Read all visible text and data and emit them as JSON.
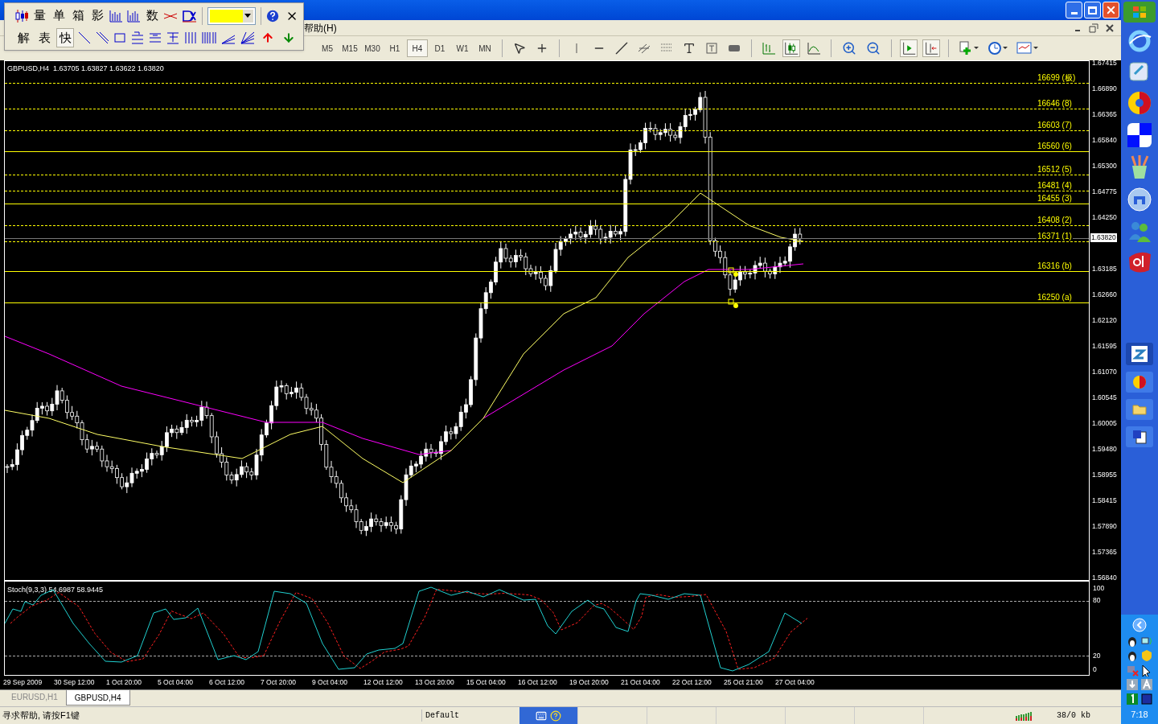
{
  "menu_bar": {
    "items": [
      "帮助(H)"
    ]
  },
  "floating_toolbar": {
    "row1": [
      {
        "kind": "icon"
      },
      {
        "kind": "text",
        "label": "量"
      },
      {
        "kind": "text",
        "label": "单"
      },
      {
        "kind": "text",
        "label": "箱"
      },
      {
        "kind": "text",
        "label": "影"
      },
      {
        "kind": "icon"
      },
      {
        "kind": "icon"
      },
      {
        "kind": "text",
        "label": "数"
      },
      {
        "kind": "icon"
      },
      {
        "kind": "icon"
      }
    ],
    "color_picker": {
      "color": "#ffff00"
    },
    "row2": [
      {
        "kind": "text",
        "label": "解",
        "selected": false
      },
      {
        "kind": "text",
        "label": "表",
        "selected": false
      },
      {
        "kind": "text",
        "label": "快",
        "selected": true
      },
      {
        "kind": "icon"
      },
      {
        "kind": "icon"
      },
      {
        "kind": "icon"
      },
      {
        "kind": "icon"
      },
      {
        "kind": "icon"
      },
      {
        "kind": "icon"
      },
      {
        "kind": "icon"
      },
      {
        "kind": "icon"
      },
      {
        "kind": "icon"
      },
      {
        "kind": "icon"
      },
      {
        "kind": "icon"
      },
      {
        "kind": "icon"
      }
    ]
  },
  "timeframes": [
    {
      "label": "M5",
      "selected": false
    },
    {
      "label": "M15",
      "selected": false
    },
    {
      "label": "M30",
      "selected": false
    },
    {
      "label": "H1",
      "selected": false
    },
    {
      "label": "H4",
      "selected": true
    },
    {
      "label": "D1",
      "selected": false
    },
    {
      "label": "W1",
      "selected": false
    },
    {
      "label": "MN",
      "selected": false
    }
  ],
  "chart": {
    "header": "GBPUSD,H4  1.63705 1.63827 1.63622 1.63820",
    "price_ticks": [
      "1.67415",
      "1.66890",
      "1.66365",
      "1.65840",
      "1.65300",
      "1.64775",
      "1.64250",
      "1.63185",
      "1.62660",
      "1.62120",
      "1.61595",
      "1.61070",
      "1.60545",
      "1.60005",
      "1.59480",
      "1.58955",
      "1.58415",
      "1.57890",
      "1.57365",
      "1.56840"
    ],
    "current_price": "1.63820",
    "fib_levels": [
      {
        "label": "16699 (极)",
        "dashed": true
      },
      {
        "label": "16646 (8)",
        "dashed": true
      },
      {
        "label": "16603 (7)",
        "dashed": true
      },
      {
        "label": "16560 (6)",
        "dashed": false
      },
      {
        "label": "16512 (5)",
        "dashed": true
      },
      {
        "label": "16481 (4)",
        "dashed": true
      },
      {
        "label": "16455 (3)",
        "dashed": false
      },
      {
        "label": "16408 (2)",
        "dashed": true
      },
      {
        "label": "16371 (1)",
        "dashed": true
      },
      {
        "label": "16316 (b)",
        "dashed": false
      },
      {
        "label": "16250 (a)",
        "dashed": false
      }
    ]
  },
  "stochastic": {
    "header": "Stoch(9,3,3) 54.6987 58.9445",
    "ticks": [
      "100",
      "80",
      "20",
      "0"
    ]
  },
  "time_labels": [
    "29 Sep 2009",
    "30 Sep 12:00",
    "1 Oct 20:00",
    "5 Oct 04:00",
    "6 Oct 12:00",
    "7 Oct 20:00",
    "9 Oct 04:00",
    "12 Oct 12:00",
    "13 Oct 20:00",
    "15 Oct 04:00",
    "16 Oct 12:00",
    "19 Oct 20:00",
    "21 Oct 04:00",
    "22 Oct 12:00",
    "25 Oct 21:00",
    "27 Oct 04:00"
  ],
  "tabs": [
    {
      "label": "EURUSD,H1",
      "selected": false
    },
    {
      "label": "GBPUSD,H4",
      "selected": true
    }
  ],
  "status_bar": {
    "help": "寻求帮助, 请按F1键",
    "profile": "Default",
    "traffic": "38/0 kb"
  },
  "taskbar": {
    "clock": "7:18"
  }
}
